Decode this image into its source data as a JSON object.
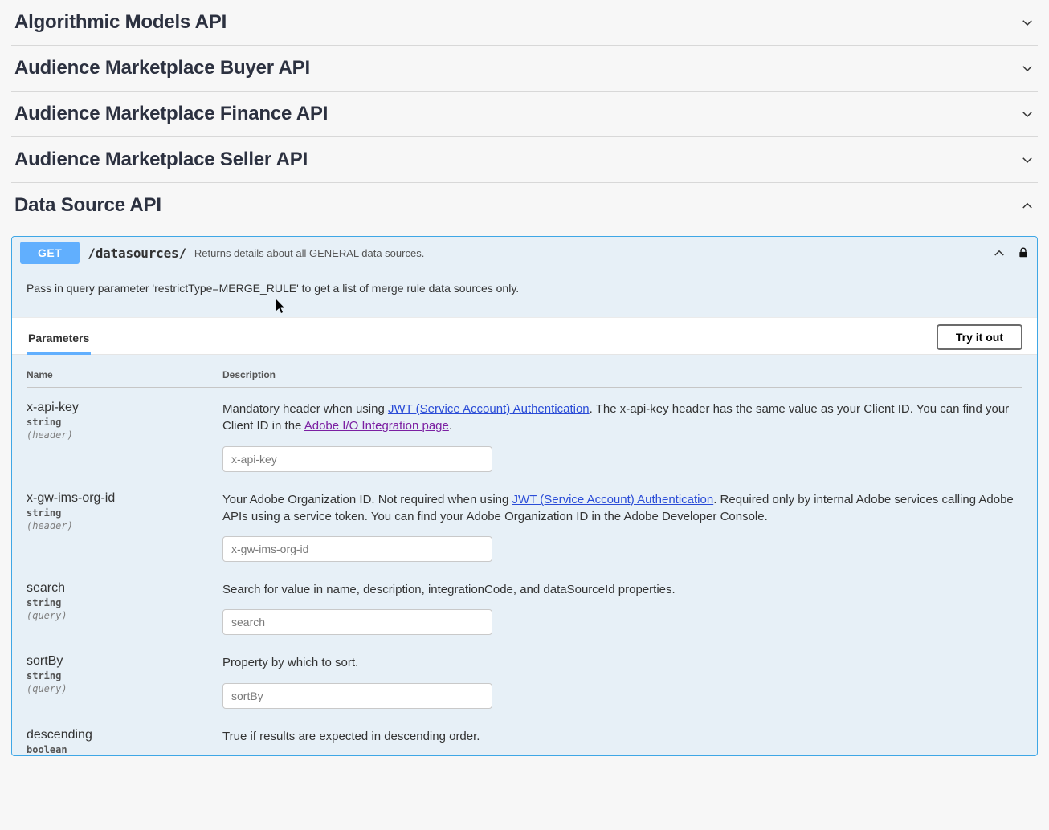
{
  "sections": {
    "s0": "Algorithmic Models API",
    "s1": "Audience Marketplace Buyer API",
    "s2": "Audience Marketplace Finance API",
    "s3": "Audience Marketplace Seller API",
    "s4": "Data Source API"
  },
  "operation": {
    "method": "GET",
    "path": "/datasources/",
    "summary": "Returns details about all GENERAL data sources.",
    "description": "Pass in query parameter 'restrictType=MERGE_RULE' to get a list of merge rule data sources only.",
    "parameters_label": "Parameters",
    "try_label": "Try it out",
    "head_name": "Name",
    "head_desc": "Description"
  },
  "params": {
    "p0": {
      "name": "x-api-key",
      "type": "string",
      "in": "(header)",
      "placeholder": "x-api-key",
      "desc_pre": "Mandatory header when using ",
      "link1_text": "JWT (Service Account) Authentication",
      "desc_mid": ". The x-api-key header has the same value as your Client ID. You can find your Client ID in the ",
      "link2_text": "Adobe I/O Integration page",
      "desc_post": "."
    },
    "p1": {
      "name": "x-gw-ims-org-id",
      "type": "string",
      "in": "(header)",
      "placeholder": "x-gw-ims-org-id",
      "desc_pre": "Your Adobe Organization ID. Not required when using ",
      "link1_text": "JWT (Service Account) Authentication",
      "desc_post": ". Required only by internal Adobe services calling Adobe APIs using a service token. You can find your Adobe Organization ID in the Adobe Developer Console."
    },
    "p2": {
      "name": "search",
      "type": "string",
      "in": "(query)",
      "placeholder": "search",
      "desc": "Search for value in name, description, integrationCode, and dataSourceId properties."
    },
    "p3": {
      "name": "sortBy",
      "type": "string",
      "in": "(query)",
      "placeholder": "sortBy",
      "desc": "Property by which to sort."
    },
    "p4": {
      "name": "descending",
      "type": "boolean",
      "desc": "True if results are expected in descending order."
    }
  }
}
